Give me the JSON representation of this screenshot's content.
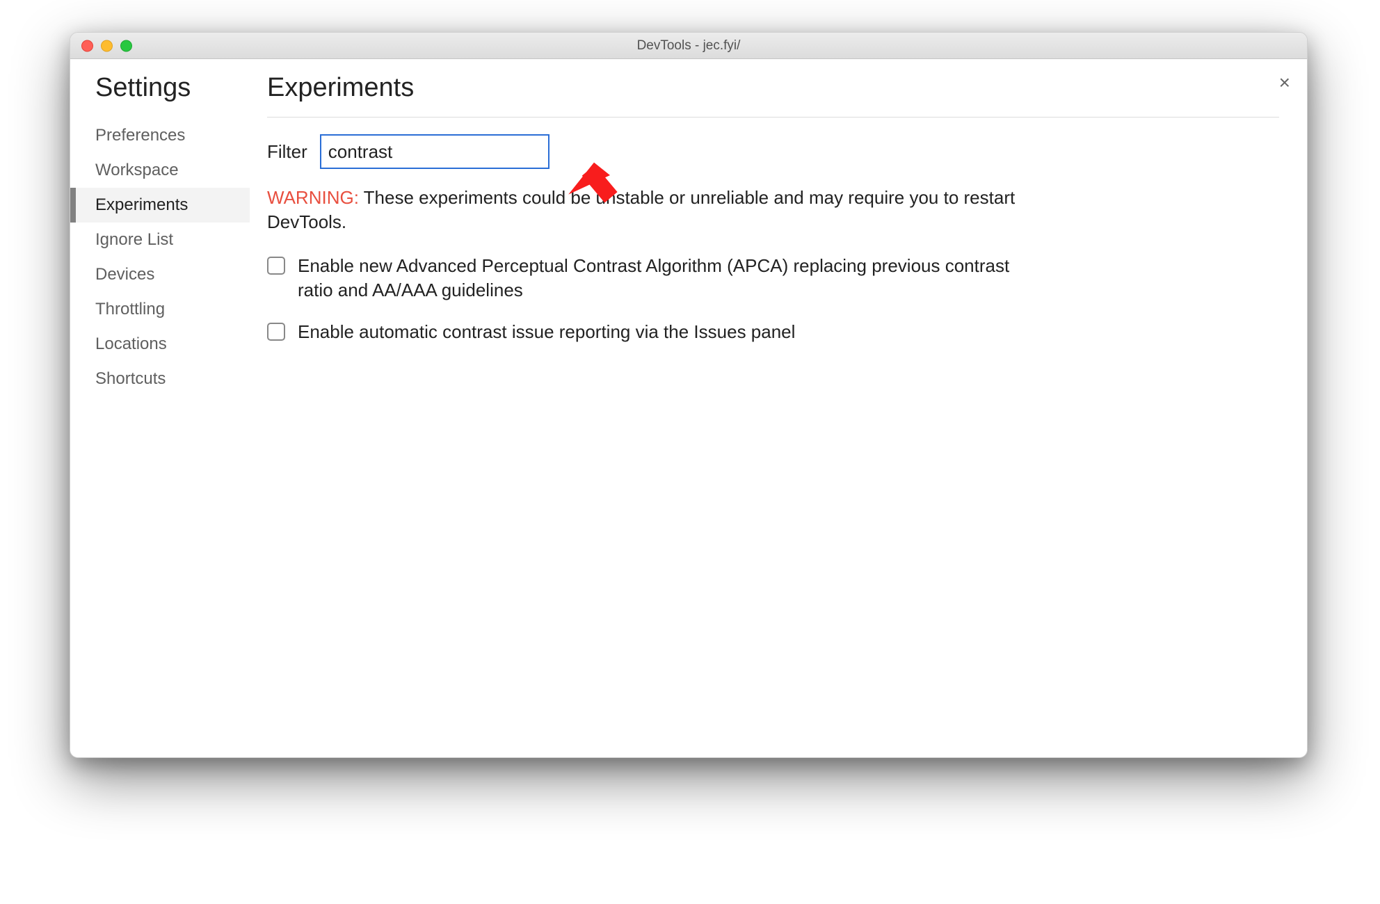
{
  "titlebar": {
    "title": "DevTools - jec.fyi/"
  },
  "sidebar": {
    "title": "Settings",
    "items": [
      {
        "label": "Preferences"
      },
      {
        "label": "Workspace"
      },
      {
        "label": "Experiments"
      },
      {
        "label": "Ignore List"
      },
      {
        "label": "Devices"
      },
      {
        "label": "Throttling"
      },
      {
        "label": "Locations"
      },
      {
        "label": "Shortcuts"
      }
    ],
    "active_index": 2
  },
  "main": {
    "title": "Experiments",
    "filter_label": "Filter",
    "filter_value": "contrast",
    "warning_prefix": "WARNING:",
    "warning_body": " These experiments could be unstable or unreliable and may require you to restart DevTools.",
    "experiments": [
      {
        "label": "Enable new Advanced Perceptual Contrast Algorithm (APCA) replacing previous contrast ratio and AA/AAA guidelines",
        "checked": false
      },
      {
        "label": "Enable automatic contrast issue reporting via the Issues panel",
        "checked": false
      }
    ]
  },
  "close": "×",
  "annotation": {
    "arrow_color": "#f81d1d"
  }
}
